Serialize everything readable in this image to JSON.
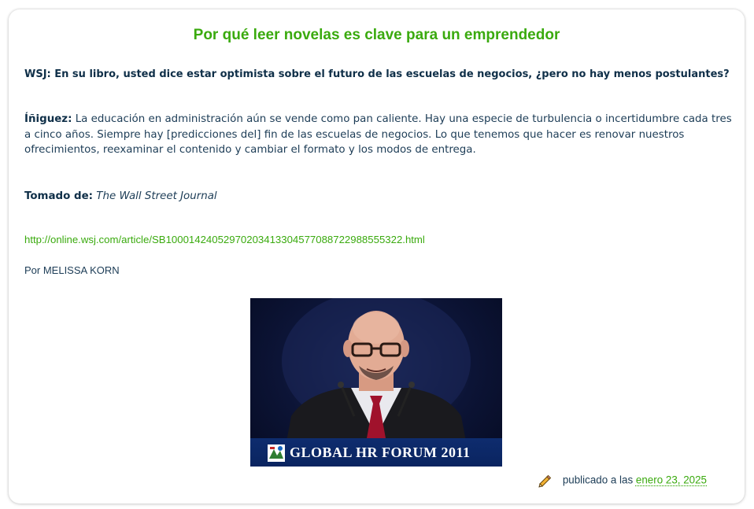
{
  "post": {
    "title": "Por qué leer novelas es clave para un emprendedor",
    "question": "WSJ: En su libro, usted dice estar optimista sobre el futuro de las escuelas de negocios, ¿pero no hay menos postulantes?",
    "answer_speaker": "Íñiguez:",
    "answer_text": " La educación en administración aún se vende como pan caliente. Hay una especie de turbulencia o incertidumbre cada tres a cinco años. Siempre hay [predicciones del] fin de las escuelas de negocios. Lo que tenemos que hacer es renovar nuestros ofrecimientos, reexaminar el contenido y cambiar el formato y los modos de entrega.",
    "source_label": "Tomado de:",
    "source_name": "The Wall Street Journal",
    "source_url": "http://online.wsj.com/article/SB10001424052970203413304577088722988555322.html",
    "author": "Por MELISSA KORN",
    "image_banner_text": "GLOBAL HR FORUM 2011"
  },
  "footer": {
    "published_label": "publicado a las",
    "date": "enero 23, 2025",
    "icon": "pencil-icon"
  },
  "colors": {
    "accent_green": "#3aaa0e",
    "text_navy": "#1c3c56"
  }
}
